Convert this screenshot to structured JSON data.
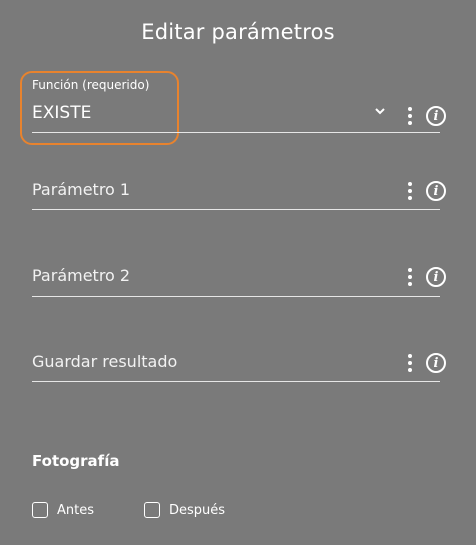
{
  "dialog": {
    "title": "Editar parámetros"
  },
  "fields": {
    "function": {
      "label": "Función (requerido)",
      "value": "EXISTE",
      "dropdown_icon": "chevron-down-icon",
      "menu_icon": "kebab-menu-icon",
      "info_icon": "info-icon",
      "info_glyph": "i"
    },
    "param1": {
      "placeholder": "Parámetro 1",
      "info_glyph": "i"
    },
    "param2": {
      "placeholder": "Parámetro 2",
      "info_glyph": "i"
    },
    "save_result": {
      "placeholder": "Guardar resultado",
      "info_glyph": "i"
    }
  },
  "photo": {
    "title": "Fotografía",
    "options": [
      {
        "label": "Antes",
        "checked": false
      },
      {
        "label": "Después",
        "checked": false
      }
    ]
  },
  "colors": {
    "background": "#7a7a7a",
    "text": "#ffffff",
    "highlight": "#e8832e"
  }
}
